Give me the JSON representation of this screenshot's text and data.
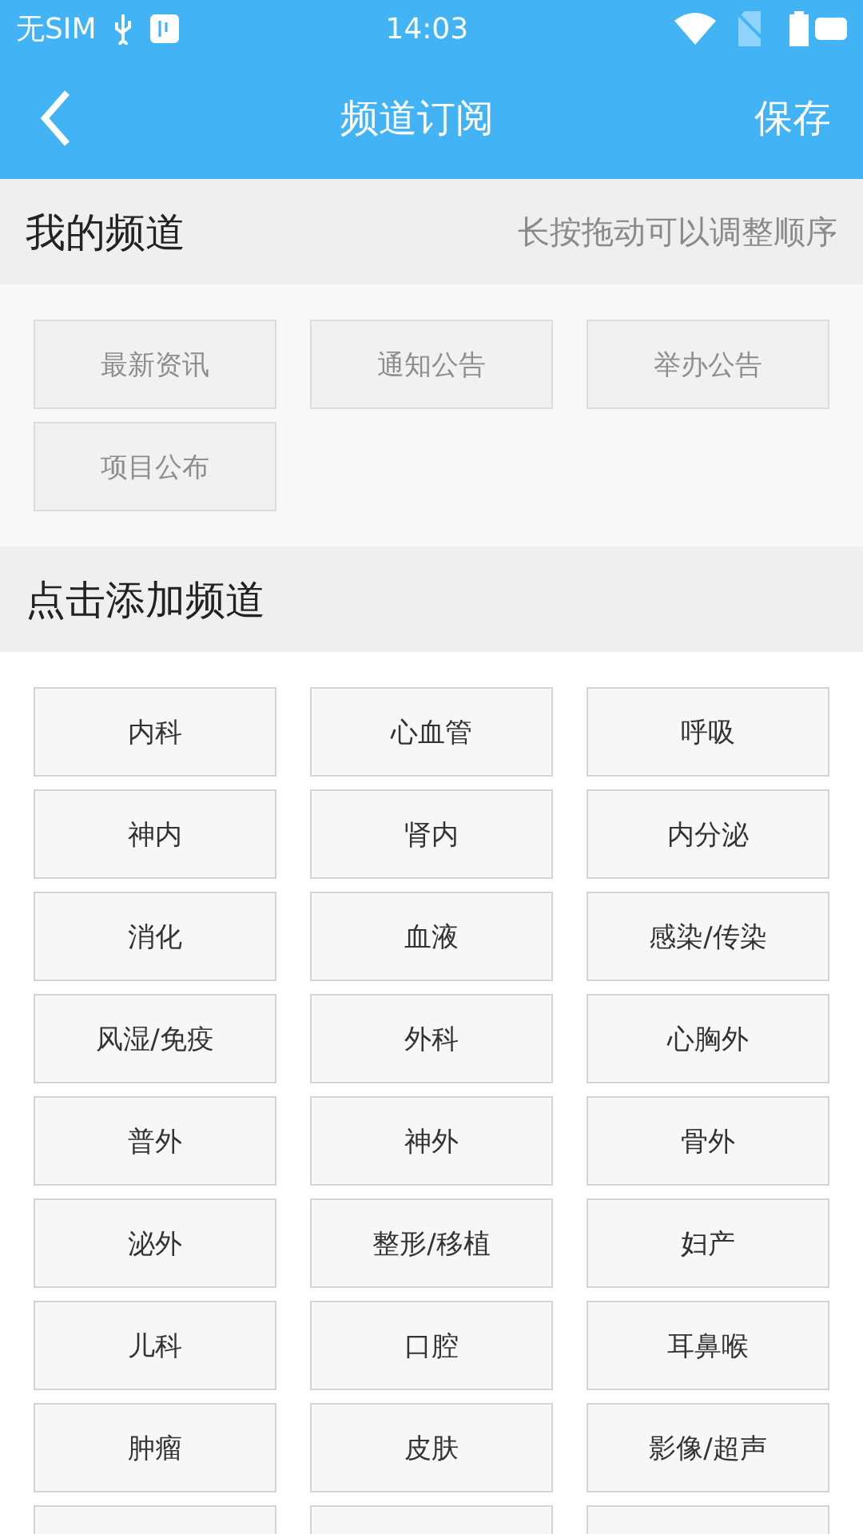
{
  "status_bar": {
    "carrier": "无SIM",
    "time": "14:03"
  },
  "toolbar": {
    "title": "频道订阅",
    "action": "保存"
  },
  "my_channels": {
    "title": "我的频道",
    "hint": "长按拖动可以调整顺序",
    "items": [
      {
        "label": "最新资讯",
        "disabled": true
      },
      {
        "label": "通知公告",
        "disabled": true
      },
      {
        "label": "举办公告",
        "disabled": true
      },
      {
        "label": "项目公布",
        "disabled": true
      }
    ]
  },
  "add_channels": {
    "title": "点击添加频道",
    "items": [
      {
        "label": "内科",
        "disabled": false
      },
      {
        "label": "心血管",
        "disabled": false
      },
      {
        "label": "呼吸",
        "disabled": false
      },
      {
        "label": "神内",
        "disabled": false
      },
      {
        "label": "肾内",
        "disabled": false
      },
      {
        "label": "内分泌",
        "disabled": false
      },
      {
        "label": "消化",
        "disabled": false
      },
      {
        "label": "血液",
        "disabled": false
      },
      {
        "label": "感染/传染",
        "disabled": false
      },
      {
        "label": "风湿/免疫",
        "disabled": false
      },
      {
        "label": "外科",
        "disabled": false
      },
      {
        "label": "心胸外",
        "disabled": false
      },
      {
        "label": "普外",
        "disabled": false
      },
      {
        "label": "神外",
        "disabled": false
      },
      {
        "label": "骨外",
        "disabled": false
      },
      {
        "label": "泌外",
        "disabled": false
      },
      {
        "label": "整形/移植",
        "disabled": false
      },
      {
        "label": "妇产",
        "disabled": false
      },
      {
        "label": "儿科",
        "disabled": false
      },
      {
        "label": "口腔",
        "disabled": false
      },
      {
        "label": "耳鼻喉",
        "disabled": false
      },
      {
        "label": "肿瘤",
        "disabled": false
      },
      {
        "label": "皮肤",
        "disabled": false
      },
      {
        "label": "影像/超声",
        "disabled": false
      }
    ]
  }
}
